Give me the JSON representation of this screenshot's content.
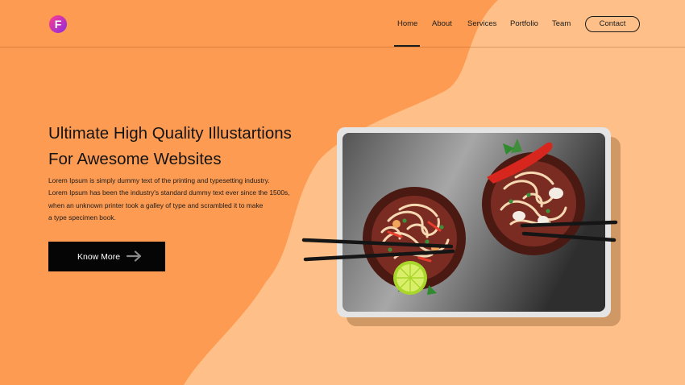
{
  "brand": {
    "logo_letter": "F"
  },
  "nav": {
    "items": [
      {
        "label": "Home",
        "active": true
      },
      {
        "label": "About"
      },
      {
        "label": "Services"
      },
      {
        "label": "Portfolio"
      },
      {
        "label": "Team"
      }
    ],
    "contact_label": "Contact"
  },
  "hero": {
    "title_line1": "Ultimate High Quality Illustartions",
    "title_line2": "For Awesome Websites",
    "body_line1": "Lorem Ipsum is simply dummy text of the printing and typesetting industry.",
    "body_line2": "Lorem Ipsum has been the industry's standard dummy text ever since the 1500s,",
    "body_line3": "when an unknown printer took a galley of type and scrambled it to make",
    "body_line4": "a type specimen book.",
    "button_label": "Know More"
  },
  "colors": {
    "background": "#fe9b52",
    "wave": "#fec088",
    "button": "#050505",
    "logo_gradient": [
      "#ff3d8b",
      "#8a2be2"
    ]
  },
  "icons": [
    "logo-icon",
    "arrow-right-icon"
  ]
}
